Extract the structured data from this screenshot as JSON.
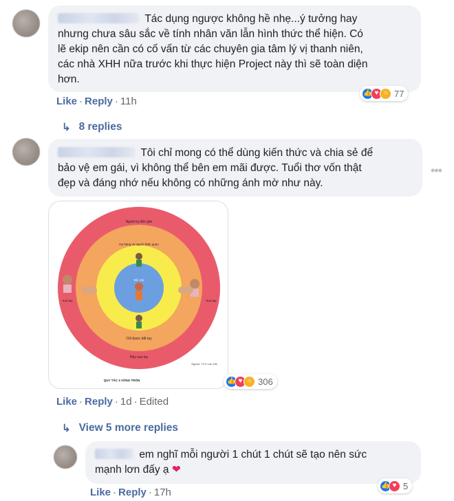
{
  "comments": [
    {
      "text": "Tác dụng ngược không hề nhẹ...ý tưởng hay nhưng chưa sâu sắc về tính nhân văn lẫn hình thức thể hiện. Có lẽ ekip nên cần có cố vấn từ các chuyên gia tâm lý vị thanh niên, các nhà XHH nữa trước khi thực hiện Project này thì sẽ toàn diện hơn.",
      "lines": [
        "Tác dụng ngược không hề nhẹ...ý tưởng hay",
        "nhưng chưa sâu sắc về tính nhân văn lẫn hình thức thể hiện. Có",
        "lẽ ekip nên cần có cố vấn từ các chuyên gia tâm lý vị thanh niên,",
        "các nhà XHH nữa trước khi thực hiện Project này thì sẽ toàn diện",
        "hơn."
      ],
      "like": "Like",
      "reply": "Reply",
      "time": "11h",
      "reaction_count": "77",
      "replies_label": "8 replies"
    },
    {
      "lines": [
        "Tôi chỉ mong có thể dùng kiến thức và chia sẻ để",
        "bảo vệ em gái, vì không thể bên em mãi được. Tuổi thơ vốn thật",
        "đẹp và đáng nhớ nếu không có những ánh mờ như này."
      ],
      "like": "Like",
      "reply": "Reply",
      "time": "1d",
      "edited": "Edited",
      "reaction_count": "306",
      "replies_label": "View 5 more replies",
      "image": {
        "circle_labels": {
          "outer_top": "Người lạ đến gần",
          "middle_top": "Họ hàng và người thân quen",
          "inner_center": "Bố, mẹ",
          "left_outer": "Xua tay",
          "right_outer": "Xua tay",
          "bottom_middle": "Chỉ được bắt tay",
          "bottom_outer": "Hãy xua tay",
          "source": "Nguồn: Th.S Lan Hải",
          "caption": "QUY TẮC 4 VÒNG TRÒN"
        }
      }
    },
    {
      "lines": [
        "em nghĩ mỗi người 1 chút 1 chút sẽ tạo nên sức",
        "mạnh lơn đấy ạ"
      ],
      "like": "Like",
      "reply": "Reply",
      "time": "17h",
      "reaction_count": "5"
    }
  ],
  "icons": {
    "reply_arrow": "reply-arrow-icon",
    "more": "more-options-icon",
    "like": "like-reaction-icon",
    "love": "love-reaction-icon",
    "wow": "wow-reaction-icon",
    "sad": "sad-reaction-icon",
    "heart": "heart-emoji-icon"
  },
  "colors": {
    "link": "#4b6aa0",
    "bubble": "#f0f2f5",
    "like": "#1877f2",
    "love": "#f33e58",
    "wow": "#f7b125"
  }
}
